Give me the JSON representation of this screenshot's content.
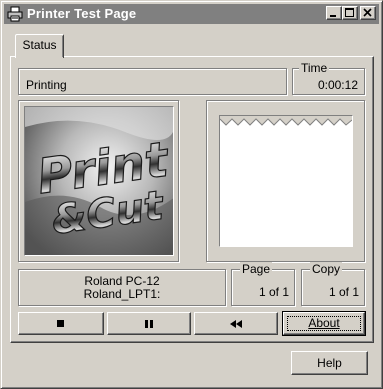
{
  "window": {
    "title": "Printer Test Page"
  },
  "tabs": [
    {
      "label": "Status"
    }
  ],
  "status": {
    "text": "Printing"
  },
  "time": {
    "label": "Time",
    "value": "0:00:12"
  },
  "logo": {
    "text_line1": "Print",
    "text_line2": "&Cut"
  },
  "printer": {
    "model": "Roland PC-12",
    "port": "Roland_LPT1:"
  },
  "page": {
    "label": "Page",
    "value": "1 of 1"
  },
  "copy": {
    "label": "Copy",
    "value": "1 of 1"
  },
  "controls": {
    "stop_icon": "stop-icon",
    "pause_icon": "pause-icon",
    "rewind_icon": "rewind-icon",
    "about_label": "About"
  },
  "help_label": "Help",
  "colors": {
    "face": "#d4d0c8",
    "titlebar_inactive": "#808080",
    "paper": "#ffffff"
  }
}
